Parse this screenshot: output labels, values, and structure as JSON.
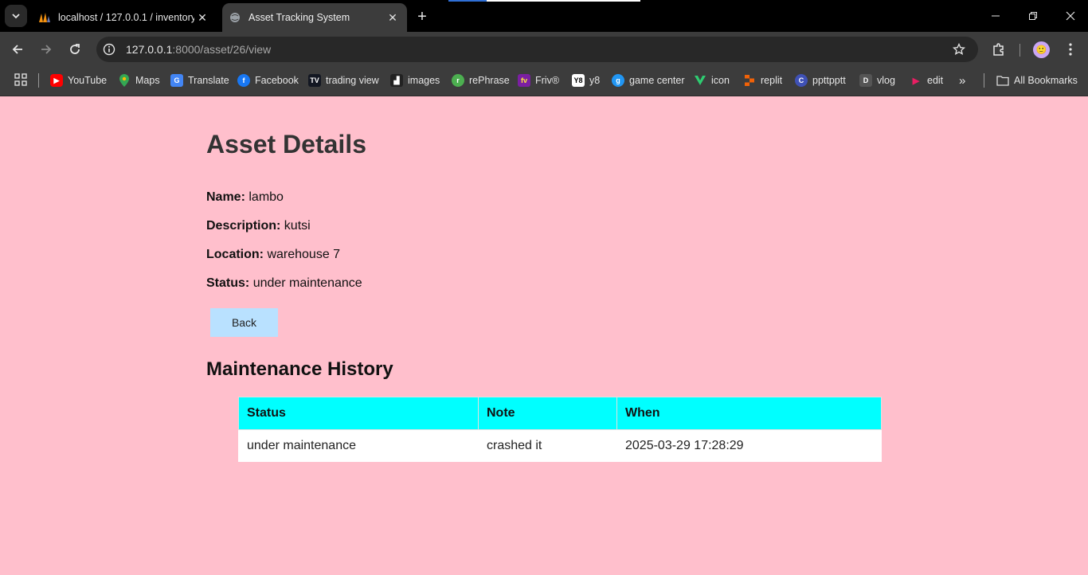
{
  "browser": {
    "tabs": [
      {
        "title": "localhost / 127.0.0.1 / inventory",
        "active": false,
        "favicon": "phpmyadmin-icon"
      },
      {
        "title": "Asset Tracking System",
        "active": true,
        "favicon": "globe-icon"
      }
    ],
    "address": {
      "host": "127.0.0.1",
      "rest": ":8000/asset/26/view"
    },
    "bookmarks": [
      {
        "label": "YouTube",
        "icon": "youtube-icon",
        "color": "#ff0000"
      },
      {
        "label": "Maps",
        "icon": "maps-icon",
        "color": "#34a853"
      },
      {
        "label": "Translate",
        "icon": "translate-icon",
        "color": "#4285f4"
      },
      {
        "label": "Facebook",
        "icon": "facebook-icon",
        "color": "#1877f2"
      },
      {
        "label": "trading view",
        "icon": "tradingview-icon",
        "color": "#131722"
      },
      {
        "label": "images",
        "icon": "images-icon",
        "color": "#222222"
      },
      {
        "label": "rePhrase",
        "icon": "rephrase-icon",
        "color": "#4caf50"
      },
      {
        "label": "Friv®",
        "icon": "friv-icon",
        "color": "#7b1fa2"
      },
      {
        "label": "y8",
        "icon": "y8-icon",
        "color": "#ffffff"
      },
      {
        "label": "game center",
        "icon": "game-center-icon",
        "color": "#2196f3"
      },
      {
        "label": "icon",
        "icon": "icon-icon",
        "color": "#2ecc71"
      },
      {
        "label": "replit",
        "icon": "replit-icon",
        "color": "#f26207"
      },
      {
        "label": "ppttpptt",
        "icon": "ppttpptt-icon",
        "color": "#3f51b5"
      },
      {
        "label": "vlog",
        "icon": "vlog-icon",
        "color": "#555555"
      },
      {
        "label": "edit",
        "icon": "edit-icon",
        "color": "#e91e63"
      }
    ],
    "all_bookmarks": "All Bookmarks"
  },
  "page": {
    "title": "Asset Details",
    "fields": [
      {
        "label": "Name:",
        "value": "lambo"
      },
      {
        "label": "Description:",
        "value": "kutsi"
      },
      {
        "label": "Location:",
        "value": "warehouse 7"
      },
      {
        "label": "Status:",
        "value": "under maintenance"
      }
    ],
    "back_label": "Back",
    "history_title": "Maintenance History",
    "history_headers": [
      "Status",
      "Note",
      "When"
    ],
    "history_rows": [
      [
        "under maintenance",
        "crashed it",
        "2025-03-29 17:28:29"
      ]
    ]
  },
  "colors": {
    "page_bg": "#ffbfcc",
    "table_header": "#00ffff",
    "back_button": "#b9e1ff"
  }
}
